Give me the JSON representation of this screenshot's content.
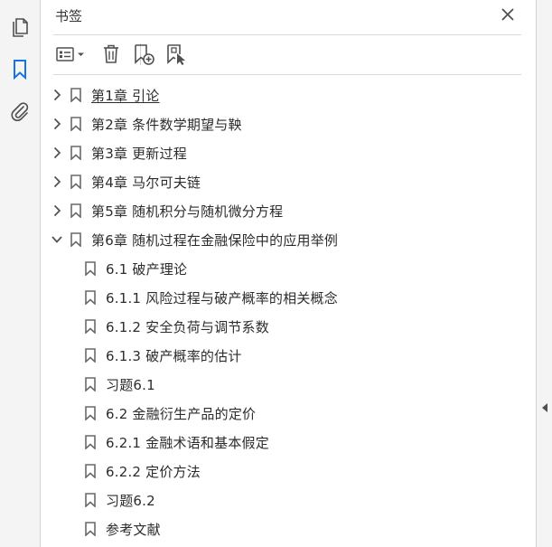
{
  "sidebar_icons": [
    "pages-icon",
    "bookmark-icon",
    "attachment-icon"
  ],
  "panel": {
    "title": "书签"
  },
  "toolbar": {
    "buttons": [
      "options-menu-icon",
      "delete-bookmark-icon",
      "new-bookmark-icon",
      "new-bookmark-from-structure-icon"
    ]
  },
  "bookmarks": [
    {
      "label": "第1章  引论",
      "level": 1,
      "state": "collapsed"
    },
    {
      "label": "第2章  条件数学期望与鞅",
      "level": 1,
      "state": "collapsed"
    },
    {
      "label": "第3章  更新过程",
      "level": 1,
      "state": "collapsed"
    },
    {
      "label": "第4章  马尔可夫链",
      "level": 1,
      "state": "collapsed"
    },
    {
      "label": "第5章  随机积分与随机微分方程",
      "level": 1,
      "state": "collapsed"
    },
    {
      "label": "第6章  随机过程在金融保险中的应用举例",
      "level": 1,
      "state": "expanded"
    },
    {
      "label": "6.1  破产理论",
      "level": 2
    },
    {
      "label": "6.1.1  风险过程与破产概率的相关概念",
      "level": 2
    },
    {
      "label": "6.1.2  安全负荷与调节系数",
      "level": 2
    },
    {
      "label": "6.1.3  破产概率的估计",
      "level": 2
    },
    {
      "label": "习题6.1",
      "level": 2
    },
    {
      "label": "6.2  金融衍生产品的定价",
      "level": 2
    },
    {
      "label": "6.2.1  金融术语和基本假定",
      "level": 2
    },
    {
      "label": "6.2.2  定价方法",
      "level": 2
    },
    {
      "label": "习题6.2",
      "level": 2
    },
    {
      "label": "参考文献",
      "level": 2
    }
  ],
  "colors": {
    "accent": "#1473e6",
    "icon": "#505050",
    "background": "#ffffff",
    "sidebar": "#f4f4f4"
  }
}
